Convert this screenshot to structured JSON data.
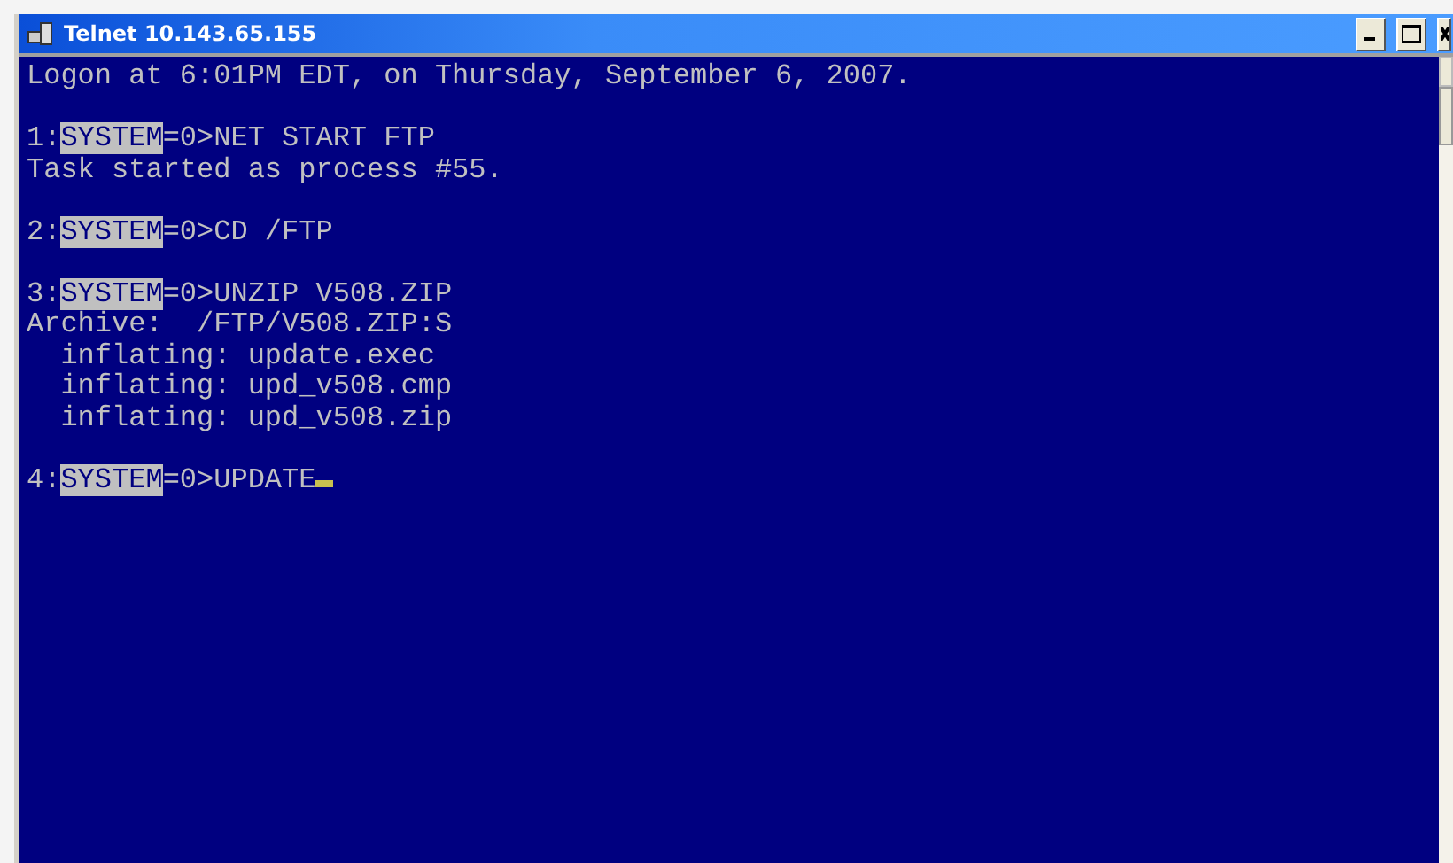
{
  "window": {
    "title": "Telnet 10.143.65.155"
  },
  "terminal": {
    "lines": [
      {
        "kind": "text",
        "text": "Logon at 6:01PM EDT, on Thursday, September 6, 2007."
      },
      {
        "kind": "blank"
      },
      {
        "kind": "prompt",
        "number": "1:",
        "user": "SYSTEM",
        "command": "=0>NET START FTP",
        "cursor": false
      },
      {
        "kind": "text",
        "text": "Task started as process #55."
      },
      {
        "kind": "blank"
      },
      {
        "kind": "prompt",
        "number": "2:",
        "user": "SYSTEM",
        "command": "=0>CD /FTP",
        "cursor": false
      },
      {
        "kind": "blank"
      },
      {
        "kind": "prompt",
        "number": "3:",
        "user": "SYSTEM",
        "command": "=0>UNZIP V508.ZIP",
        "cursor": false
      },
      {
        "kind": "text",
        "text": "Archive:  /FTP/V508.ZIP:S"
      },
      {
        "kind": "text",
        "text": "  inflating: update.exec"
      },
      {
        "kind": "text",
        "text": "  inflating: upd_v508.cmp"
      },
      {
        "kind": "text",
        "text": "  inflating: upd_v508.zip"
      },
      {
        "kind": "blank"
      },
      {
        "kind": "prompt",
        "number": "4:",
        "user": "SYSTEM",
        "command": "=0>UPDATE",
        "cursor": true
      }
    ]
  }
}
